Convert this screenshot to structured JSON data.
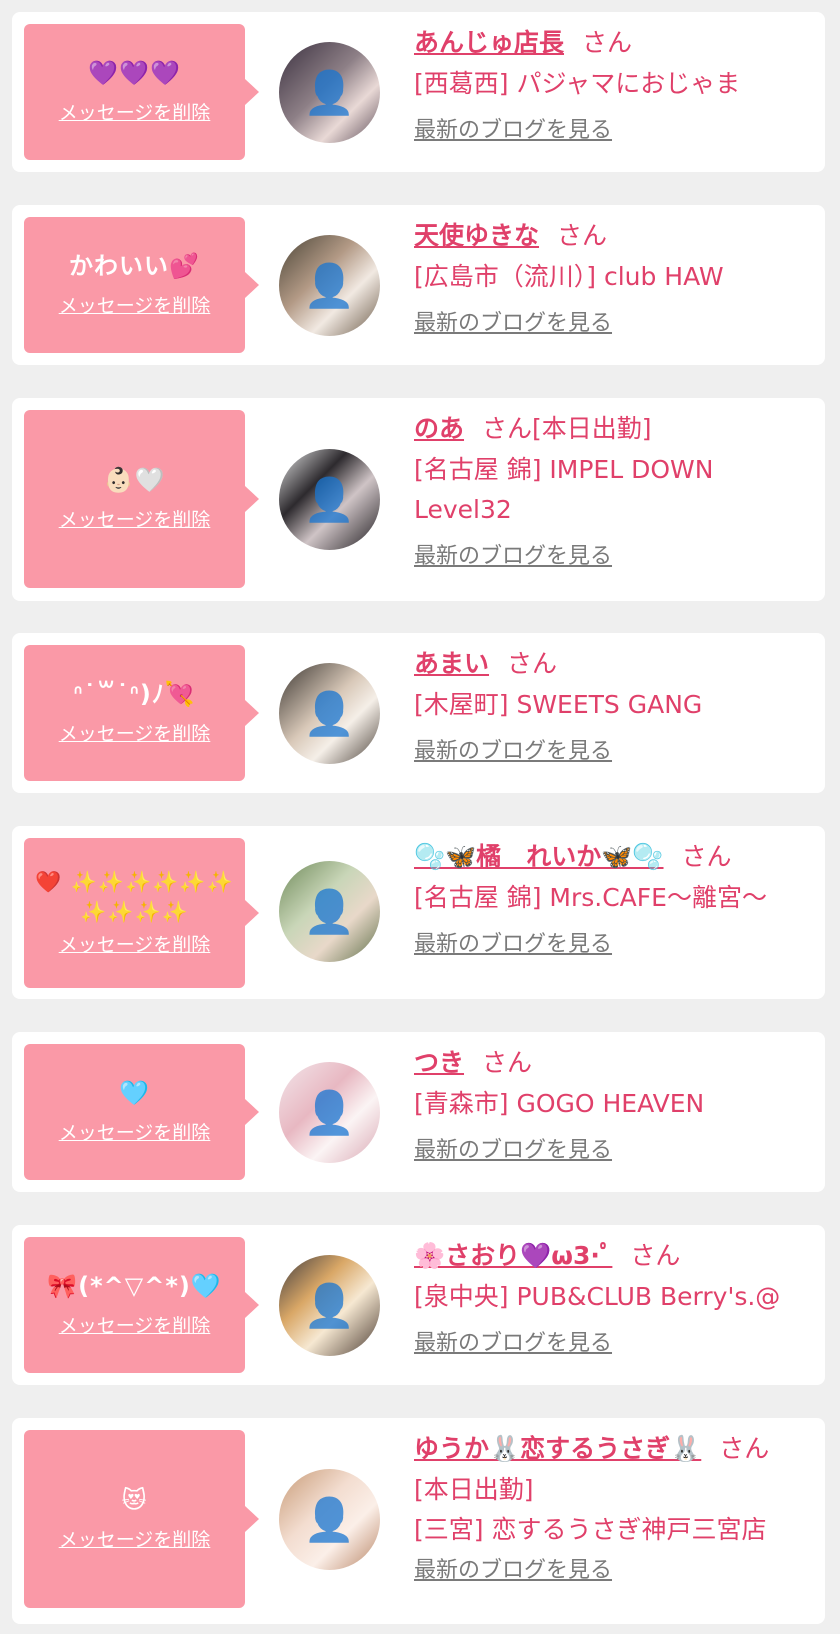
{
  "delete_label": "メッセージを削除",
  "suffix": "さん",
  "blog_label": "最新のブログを見る",
  "colors": {
    "page_bg": "#efefef",
    "bubble": "#fa99a7",
    "name_text": "#e0406a",
    "link_gray": "#7a7a7a"
  },
  "entries": [
    {
      "message": "💜💜💜",
      "name": "あんじゅ店長",
      "status": "",
      "shop": "[西葛西] パジャマにおじゃま",
      "shop2": ""
    },
    {
      "message": "かわいい💕",
      "name": "天使ゆきな",
      "status": "",
      "shop": "[広島市（流川）] club HAW",
      "shop2": ""
    },
    {
      "message": "👶🏻🤍",
      "name": "のあ",
      "status": "[本日出勤]",
      "shop": "[名古屋 錦] IMPEL DOWN Level32",
      "shop2": ""
    },
    {
      "message": "ᐢ˙꒳˙ᐢ)ﾉ💘",
      "name": "あまい",
      "status": "",
      "shop": "[木屋町] SWEETS GANG",
      "shop2": ""
    },
    {
      "message": "❤️ ✨✨✨✨✨✨ ✨✨✨✨",
      "name": "🫧🦋橘　れいか🦋🫧",
      "status": "",
      "shop": "[名古屋 錦] Mrs.CAFE～離宮～",
      "shop2": ""
    },
    {
      "message": "🩵",
      "name": "つき",
      "status": "",
      "shop": "[青森市] GOGO HEAVEN",
      "shop2": ""
    },
    {
      "message": "🎀(*^▽^*)🩵",
      "name": "🌸さおり💜ω3·ﾟ",
      "status": "",
      "shop": "[泉中央] PUB&CLUB Berry's.@",
      "shop2": ""
    },
    {
      "message": "😻",
      "name": "ゆうか🐰恋するうさぎ🐰",
      "status": "",
      "shop": "[本日出勤]",
      "shop2": "[三宮] 恋するうさぎ神戸三宮店"
    }
  ]
}
